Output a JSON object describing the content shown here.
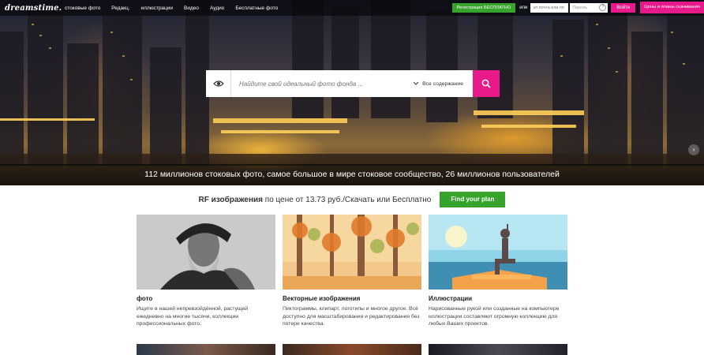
{
  "header": {
    "logo": "dreamstime.",
    "nav": [
      "стоковые фото",
      "Редакц.",
      "иллюстрации",
      "Видео",
      "Аудио",
      "Бесплатные фото"
    ],
    "register_label": "Регистрация БЕСПЛАТНО",
    "or_label": "или",
    "login_placeholder": "эл почта или пп",
    "password_placeholder": "Пароль",
    "password_help": "?",
    "login_button": "Войти",
    "prices_button": "Цены и планы скачивания"
  },
  "search": {
    "placeholder": "Найдите свой идеальный фото фонда ...",
    "scope_label": "Все содержание",
    "icons": [
      "eye-icon",
      "chevron-down-icon",
      "search-icon"
    ]
  },
  "hero": {
    "next_arrow": "›",
    "tagline": "112 миллионов стоковых фото, самое большое в мире стоковое сообщество, 26 миллионов пользователей"
  },
  "rf": {
    "bold": "RF изображения",
    "rest": " по цене от 13.73 руб./Скачать или Бесплатно",
    "button": "Find your plan"
  },
  "cards": [
    {
      "title": "фото",
      "desc": "Ищите в нашей непревзойдённой, растущей ежедневно на многие тысячи, коллекции профессиональных фото."
    },
    {
      "title": "Векторные изображения",
      "desc": "Пиктограммы, клипарт, логотипы и многое другое. Всё доступно для масштабирования и редактирования без потери качества."
    },
    {
      "title": "Иллюстрации",
      "desc": "Нарисованные рукой или созданные на компьютере иллюстрации составляют огромную коллекцию для любых Ваших проектов."
    }
  ],
  "colors": {
    "brand_pink": "#e8198b",
    "brand_green": "#36a32a"
  }
}
